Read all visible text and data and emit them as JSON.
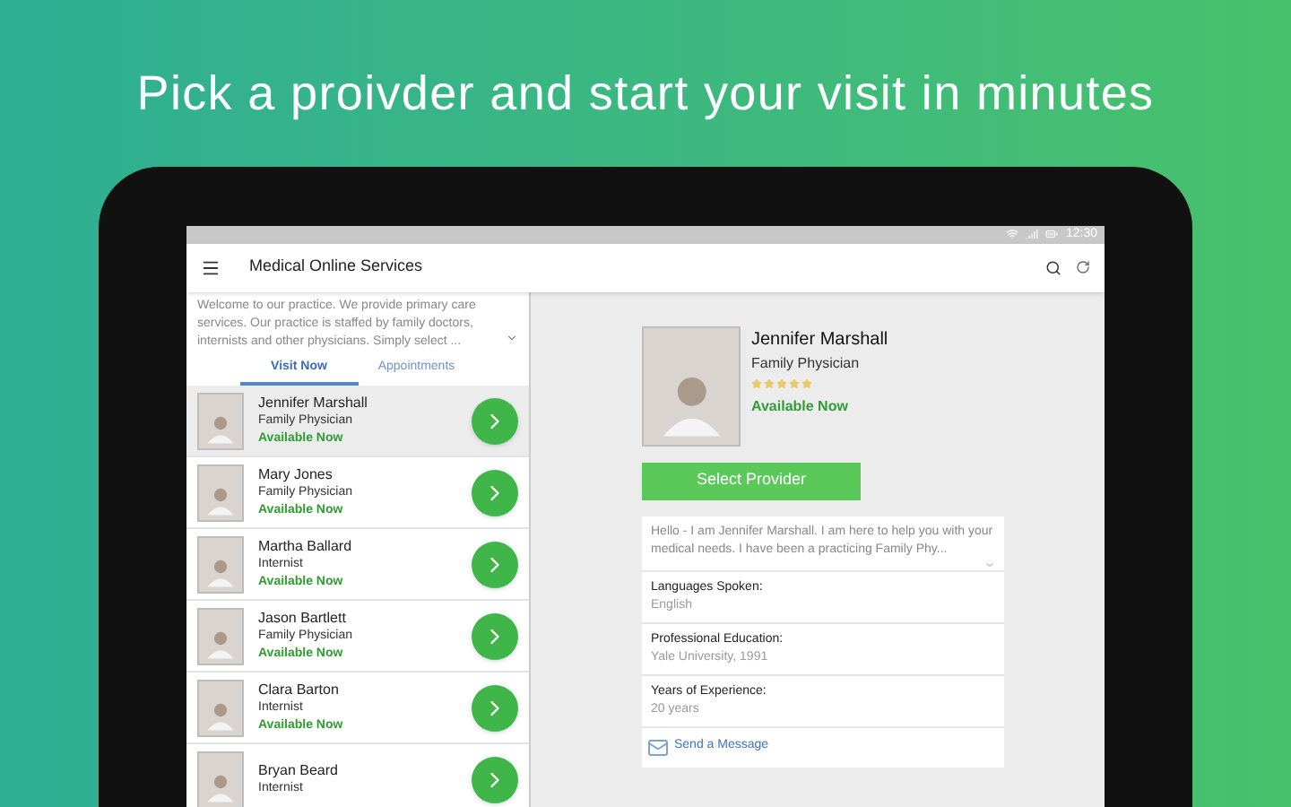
{
  "headline": "Pick a proivder and start your visit in minutes",
  "status_bar": {
    "time": "12:30"
  },
  "app_bar": {
    "title": "Medical Online Services"
  },
  "intro": "Welcome to our practice. We provide primary care services. Our practice is staffed by family doctors, internists and other physicians. Simply select ...",
  "tabs": [
    {
      "label": "Visit Now",
      "selected": true
    },
    {
      "label": "Appointments",
      "selected": false
    }
  ],
  "providers": [
    {
      "name": "Jennifer Marshall",
      "specialty": "Family Physician",
      "availability": "Available Now",
      "selected": true
    },
    {
      "name": "Mary Jones",
      "specialty": "Family Physician",
      "availability": "Available Now",
      "selected": false
    },
    {
      "name": "Martha Ballard",
      "specialty": "Internist",
      "availability": "Available Now",
      "selected": false
    },
    {
      "name": "Jason Bartlett",
      "specialty": "Family Physician",
      "availability": "Available Now",
      "selected": false
    },
    {
      "name": "Clara Barton",
      "specialty": "Internist",
      "availability": "Available Now",
      "selected": false
    },
    {
      "name": "Bryan Beard",
      "specialty": "Internist",
      "selected": false
    }
  ],
  "detail": {
    "name": "Jennifer Marshall",
    "specialty": "Family Physician",
    "stars": 5,
    "availability": "Available Now",
    "button": "Select Provider",
    "bio": "Hello - I am Jennifer Marshall. I am here to help you with your medical needs. I have been a practicing Family Phy...",
    "facts": [
      {
        "label": "Languages Spoken:",
        "value": "English"
      },
      {
        "label": "Professional Education:",
        "value": "Yale University, 1991"
      },
      {
        "label": "Years of Experience:",
        "value": "20 years"
      }
    ],
    "message_link": "Send a Message"
  }
}
